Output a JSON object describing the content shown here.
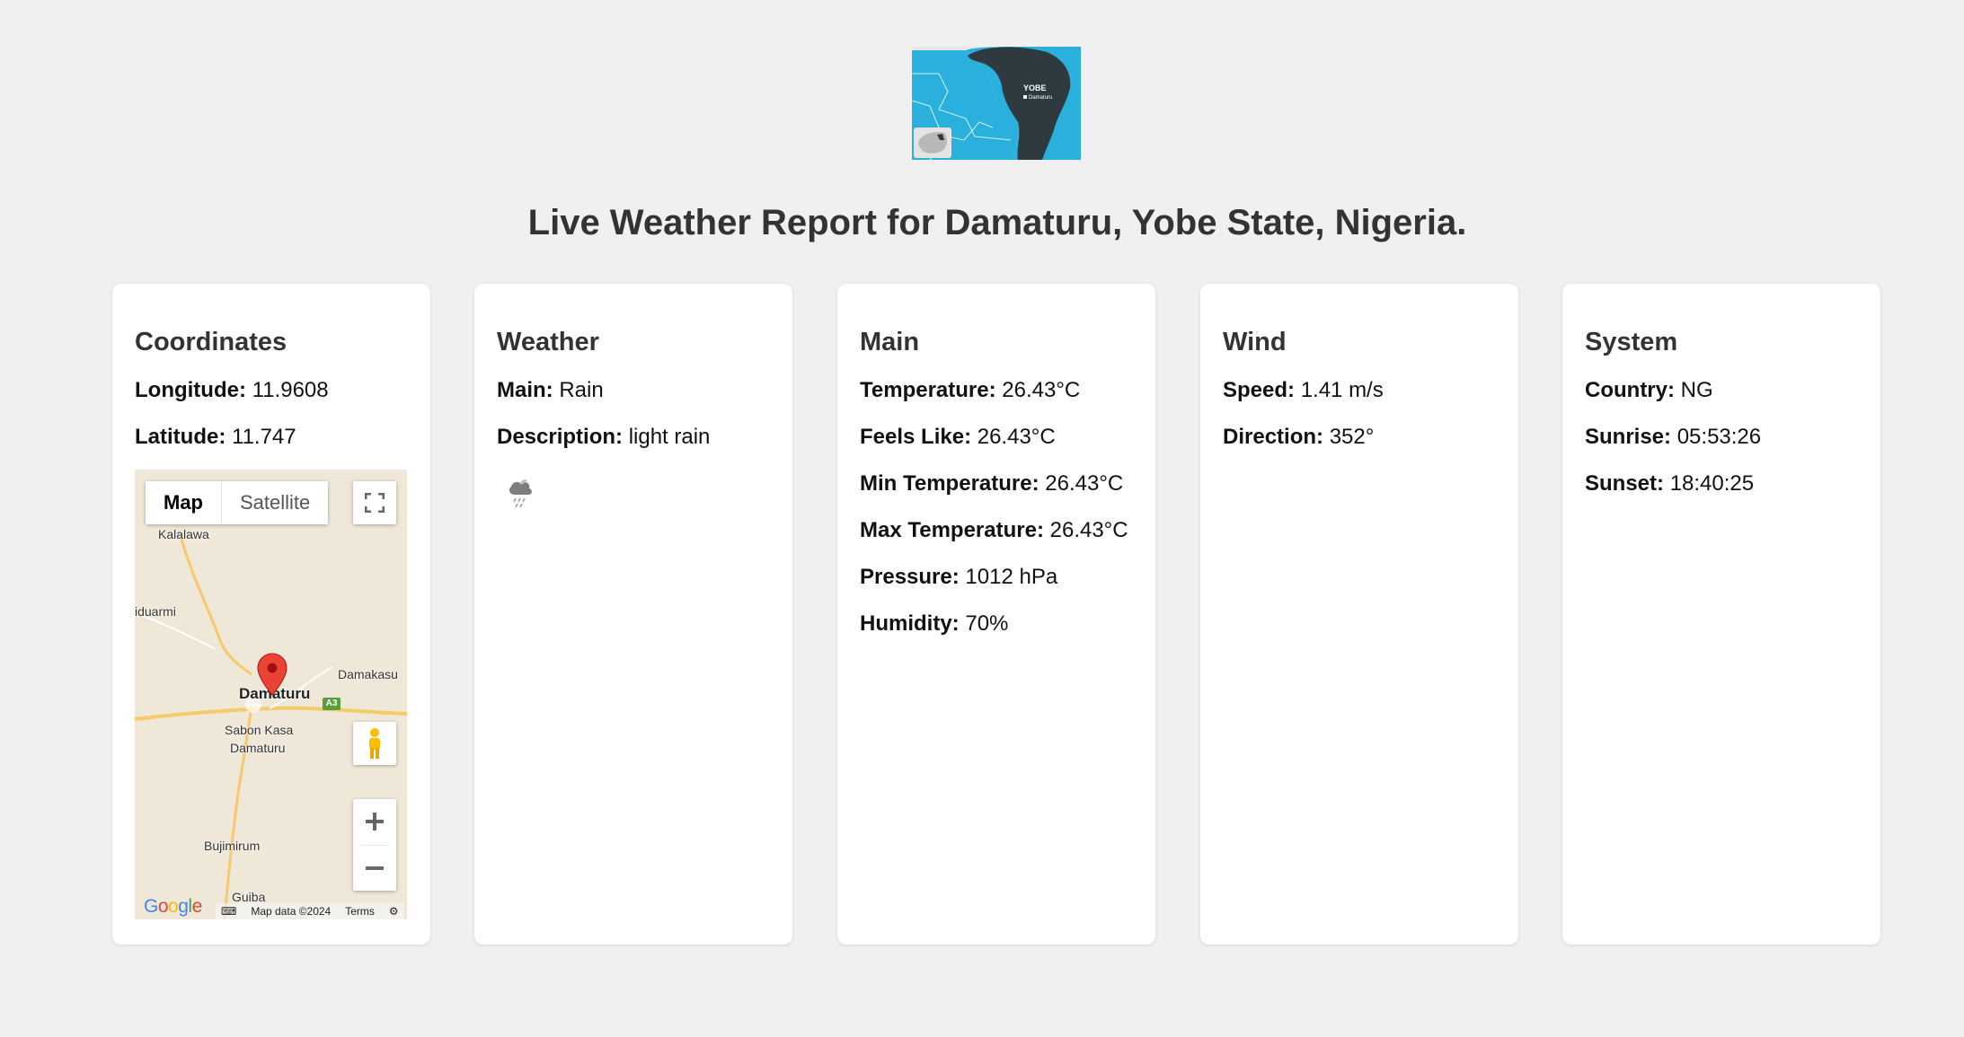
{
  "header": {
    "title": "Live Weather Report for Damaturu, Yobe State, Nigeria."
  },
  "state_map": {
    "state_label": "YOBE",
    "capital_label": "Damaturu"
  },
  "coordinates": {
    "heading": "Coordinates",
    "longitude_label": "Longitude:",
    "longitude_value": "11.9608",
    "latitude_label": "Latitude:",
    "latitude_value": "11.747",
    "map": {
      "type_map": "Map",
      "type_satellite": "Satellite",
      "places": {
        "kalalawa": "Kalalawa",
        "iduarmi": "iduarmi",
        "damaturu": "Damaturu",
        "damakasu": "Damakasu",
        "sabon_kasa": "Sabon Kasa",
        "sabon_kasa_2": "Damaturu",
        "bujimirum": "Bujimirum",
        "guiba": "Guiba",
        "road": "A3"
      },
      "footer": {
        "logo": "Google",
        "map_data": "Map data ©2024",
        "terms": "Terms"
      }
    }
  },
  "weather": {
    "heading": "Weather",
    "main_label": "Main:",
    "main_value": "Rain",
    "description_label": "Description:",
    "description_value": "light rain",
    "icon": "light-rain-icon"
  },
  "main": {
    "heading": "Main",
    "temperature_label": "Temperature:",
    "temperature_value": "26.43°C",
    "feels_like_label": "Feels Like:",
    "feels_like_value": "26.43°C",
    "min_temp_label": "Min Temperature:",
    "min_temp_value": "26.43°C",
    "max_temp_label": "Max Temperature:",
    "max_temp_value": "26.43°C",
    "pressure_label": "Pressure:",
    "pressure_value": "1012 hPa",
    "humidity_label": "Humidity:",
    "humidity_value": "70%"
  },
  "wind": {
    "heading": "Wind",
    "speed_label": "Speed:",
    "speed_value": "1.41 m/s",
    "direction_label": "Direction:",
    "direction_value": "352°"
  },
  "system": {
    "heading": "System",
    "country_label": "Country:",
    "country_value": "NG",
    "sunrise_label": "Sunrise:",
    "sunrise_value": "05:53:26",
    "sunset_label": "Sunset:",
    "sunset_value": "18:40:25"
  },
  "colors": {
    "background": "#f0f0f0",
    "card": "#ffffff",
    "map_water": "#29b0dc",
    "map_state": "#2e3a3f",
    "marker": "#ea4335"
  }
}
